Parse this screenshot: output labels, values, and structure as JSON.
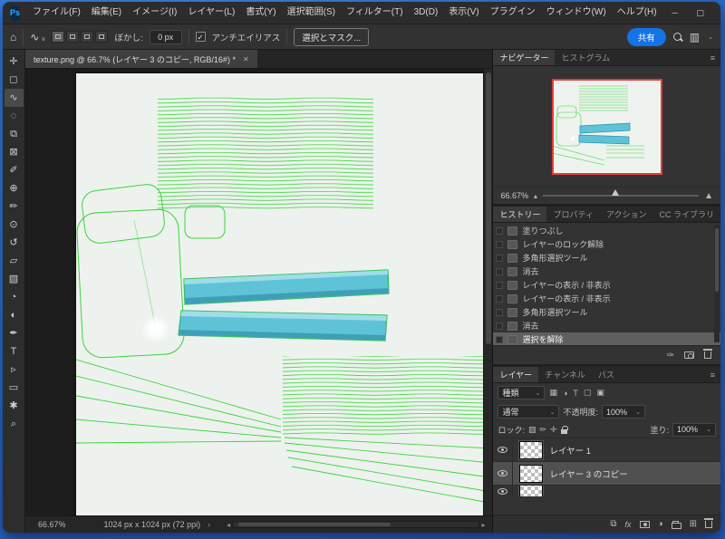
{
  "menubar": {
    "items": [
      "ファイル(F)",
      "編集(E)",
      "イメージ(I)",
      "レイヤー(L)",
      "書式(Y)",
      "選択範囲(S)",
      "フィルター(T)",
      "3D(D)",
      "表示(V)",
      "プラグイン",
      "ウィンドウ(W)",
      "ヘルプ(H)"
    ]
  },
  "icons": {
    "ps_logo": "Ps",
    "minimize": "─",
    "maximize": "▢",
    "close": "✕",
    "home": "⌂",
    "lasso": "∿",
    "tool_caret": "∨",
    "check": "✓",
    "ellipsis": "⋯",
    "quick_mask": "◨",
    "screen_mode": "▢",
    "menu": "≡",
    "chevron_down": "⌄",
    "chevron_right": "›",
    "arrow_left": "◂",
    "arrow_right": "▸",
    "slider_small": "▴",
    "slider_large": "▲",
    "workspace": "▥",
    "link": "⧉",
    "fx": "fx",
    "adjust": "◑",
    "new_layer": "⊞",
    "filter_pixel": "▦",
    "filter_adjust": "◑",
    "filter_type": "T",
    "filter_shape": "▢",
    "filter_smart": "▣",
    "lock_transparency": "▨",
    "lock_pixels": "✏",
    "lock_position": "✛",
    "lock_artboard": "⊞"
  },
  "options": {
    "feather_label": "ぼかし:",
    "feather_value": "0 px",
    "antialias_label": "アンチエイリアス",
    "select_mask_label": "選択とマスク...",
    "share_label": "共有"
  },
  "tab": {
    "title": "texture.png @ 66.7% (レイヤー 3 のコピー, RGB/16#) *"
  },
  "tools": [
    {
      "name": "move-tool",
      "glyph": "✛"
    },
    {
      "name": "marquee-tool",
      "glyph": "◻"
    },
    {
      "name": "lasso-tool",
      "glyph": "∿",
      "selected": true
    },
    {
      "name": "object-selection-tool",
      "glyph": "◌"
    },
    {
      "name": "crop-tool",
      "glyph": "⧉"
    },
    {
      "name": "frame-tool",
      "glyph": "⊠"
    },
    {
      "name": "eyedropper-tool",
      "glyph": "✐"
    },
    {
      "name": "healing-brush-tool",
      "glyph": "⊕"
    },
    {
      "name": "brush-tool",
      "glyph": "✏"
    },
    {
      "name": "clone-stamp-tool",
      "glyph": "⊙"
    },
    {
      "name": "history-brush-tool",
      "glyph": "↺"
    },
    {
      "name": "eraser-tool",
      "glyph": "▱"
    },
    {
      "name": "gradient-tool",
      "glyph": "▧"
    },
    {
      "name": "blur-tool",
      "glyph": "◔"
    },
    {
      "name": "dodge-tool",
      "glyph": "◐"
    },
    {
      "name": "pen-tool",
      "glyph": "✒"
    },
    {
      "name": "type-tool",
      "glyph": "T"
    },
    {
      "name": "path-selection-tool",
      "glyph": "▹"
    },
    {
      "name": "shape-tool",
      "glyph": "▭"
    },
    {
      "name": "hand-tool",
      "glyph": "✱"
    },
    {
      "name": "zoom-tool",
      "glyph": "⌕"
    }
  ],
  "navigator": {
    "tabs": [
      "ナビゲーター",
      "ヒストグラム"
    ],
    "zoom": "66.67%"
  },
  "history": {
    "tabs": [
      "ヒストリー",
      "プロパティ",
      "アクション",
      "CC ライブラリ"
    ],
    "items": [
      {
        "label": "塗りつぶし"
      },
      {
        "label": "レイヤーのロック解除"
      },
      {
        "label": "多角形選択ツール"
      },
      {
        "label": "消去"
      },
      {
        "label": "レイヤーの表示 / 非表示"
      },
      {
        "label": "レイヤーの表示 / 非表示"
      },
      {
        "label": "多角形選択ツール"
      },
      {
        "label": "消去"
      },
      {
        "label": "選択を解除",
        "selected": true
      }
    ]
  },
  "layers": {
    "tabs": [
      "レイヤー",
      "チャンネル",
      "パス"
    ],
    "filter_label": "種類",
    "blend_mode": "通常",
    "opacity_label": "不透明度:",
    "opacity_value": "100%",
    "lock_label": "ロック:",
    "fill_label": "塗り:",
    "fill_value": "100%",
    "items": [
      {
        "label": "レイヤー 1"
      },
      {
        "label": "レイヤー 3 のコピー",
        "selected": true
      }
    ]
  },
  "statusbar": {
    "zoom": "66.67%",
    "doc_info": "1024 px x 1024 px (72 ppi)"
  },
  "colors": {
    "accent": "#1473e6",
    "foreground_swatch": "#6fc8d8",
    "canvas_bg": "#edf2ee",
    "wire_green": "#3bd53b",
    "bar_teal": "#5fc3d8",
    "navigator_view_border": "#e63b3b"
  }
}
